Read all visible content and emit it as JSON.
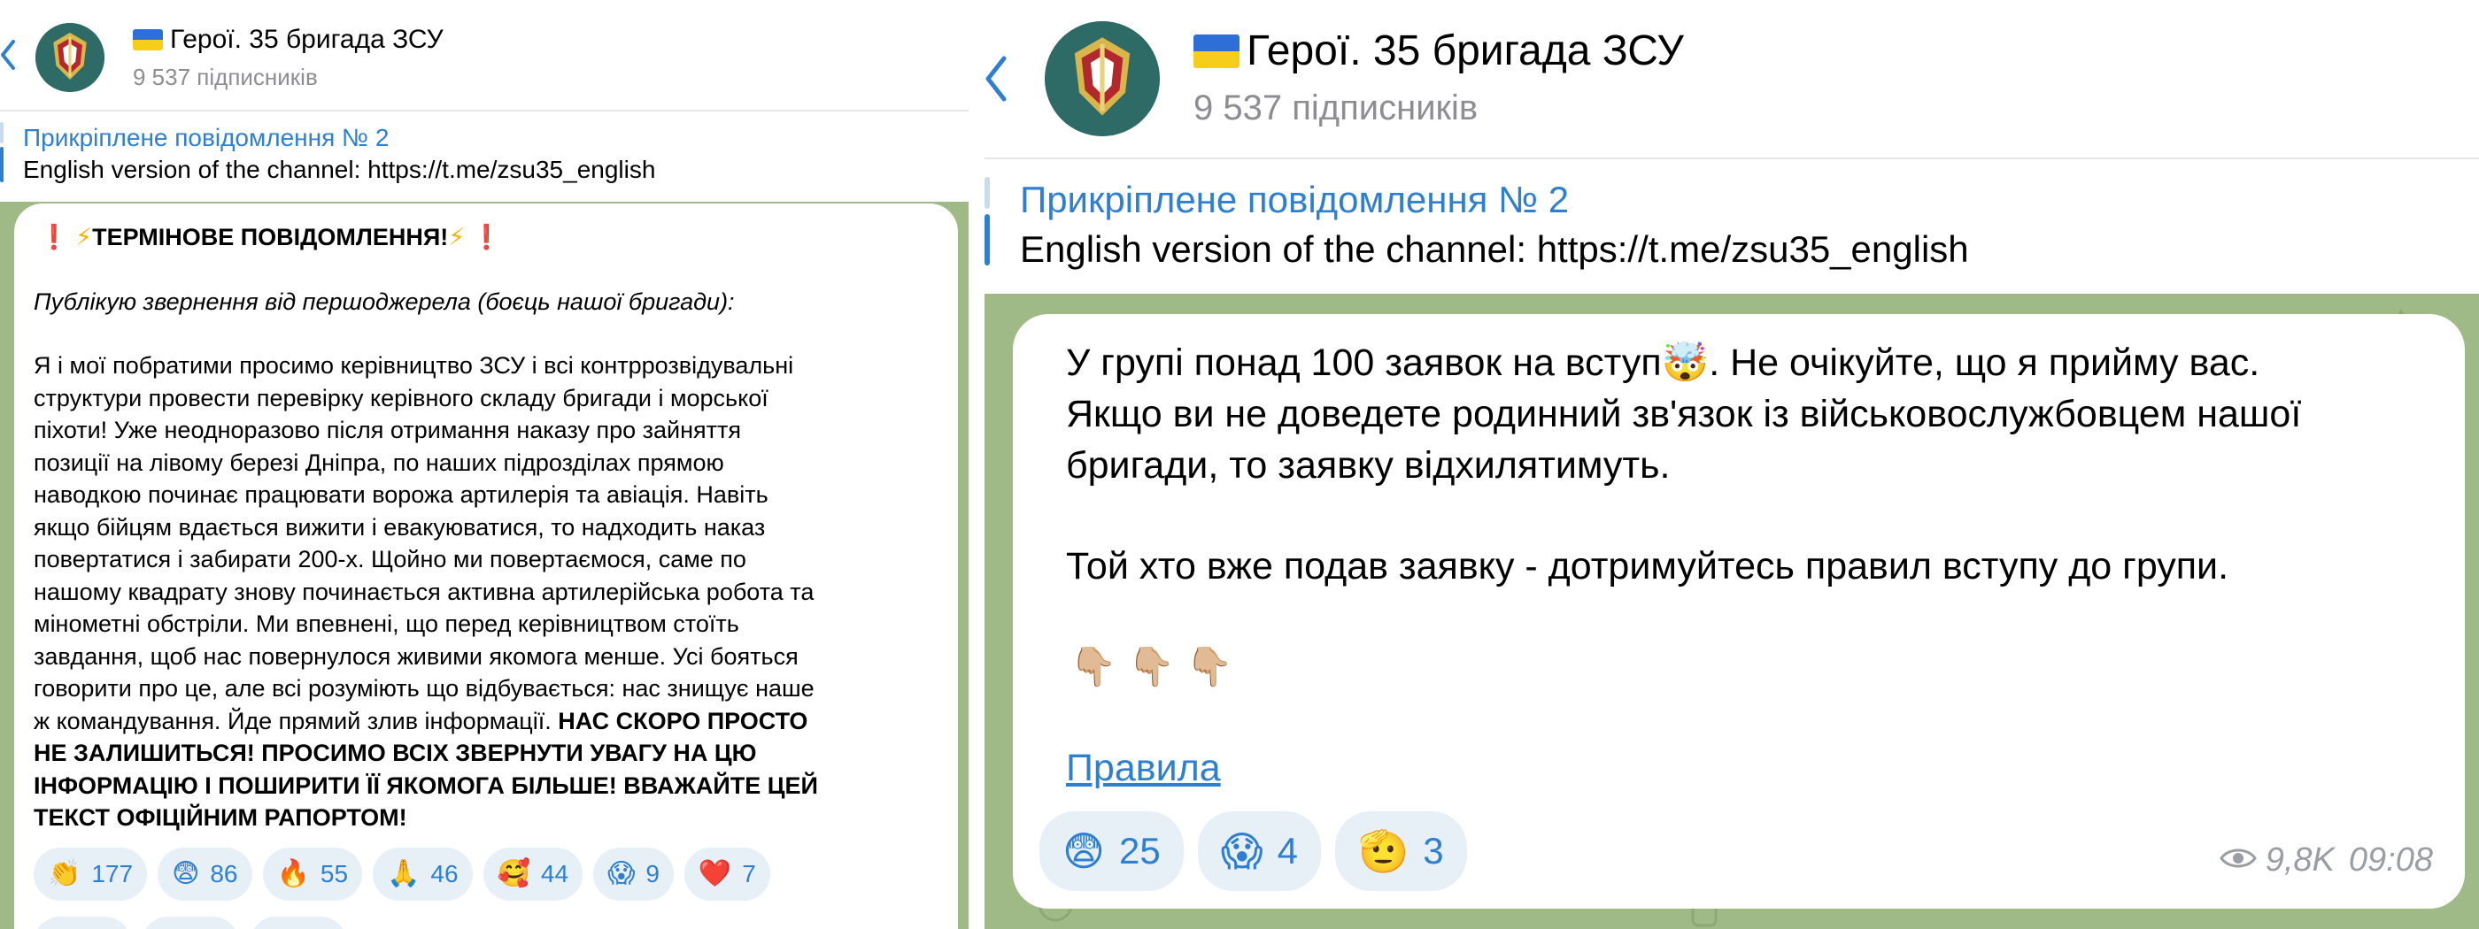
{
  "channel": {
    "name": "Герої. 35 бригада ЗСУ",
    "subscribers": "9 537 підписників",
    "colors": {
      "accent": "#2f7fd1",
      "chat_bg": "#9fba86",
      "reaction_bg": "#e8f0f7",
      "subtle": "#8d8d92"
    }
  },
  "pinned": {
    "title": "Прикріплене повідомлення № 2",
    "text": "English version of the channel: https://t.me/zsu35_english"
  },
  "left_message": {
    "headline": "ТЕРМІНОВЕ ПОВІДОМЛЕННЯ!",
    "headline_icons": [
      "red-exclamation-icon",
      "lightning-icon",
      "lightning-icon",
      "red-exclamation-icon"
    ],
    "intro": "Публікую звернення від першоджерела (боєць нашої бригади):",
    "lines": [
      "Я і мої побратими просимо керівництво ЗСУ і всі контррозвідувальні",
      "структури провести перевірку керівного складу бригади і морської",
      "піхоти! Уже неодноразово після отримання наказу про зайняття",
      "позиції на лівому березі Дніпра, по наших підрозділах прямою",
      "наводкою починає працювати ворожа артилерія та авіація. Навіть",
      "якщо бійцям вдається вижити і евакуюватися, то надходить наказ",
      "повертатися і забирати 200-х. Щойно ми повертаємося, саме по",
      "нашому квадрату знову починається активна артилерійська робота та",
      "мінометні обстріли. Ми впевнені, що перед керівництвом стоїть",
      "завдання, щоб нас повернулося живими якомога менше. Усі бояться",
      "говорити про це, але всі розуміють що відбувається: нас знищує наше"
    ],
    "last_line_plain": "ж командування. Йде прямий злив інформації. ",
    "last_line_bold": "НАС СКОРО ПРОСТО",
    "bold_lines": [
      "НЕ ЗАЛИШИТЬСЯ! ПРОСИМО ВСІХ ЗВЕРНУТИ УВАГУ НА ЦЮ",
      "ІНФОРМАЦІЮ І ПОШИРИТИ ЇЇ ЯКОМОГА БІЛЬШЕ! ВВАЖАЙТЕ ЦЕЙ",
      "ТЕКСТ ОФІЦІЙНИМ РАПОРТОМ!"
    ],
    "reactions": [
      {
        "emoji": "👏",
        "icon": "clapping-hands-icon",
        "count": "177"
      },
      {
        "emoji": "😨",
        "icon": "fearful-face-icon",
        "count": "86"
      },
      {
        "emoji": "🔥",
        "icon": "fire-icon",
        "count": "55"
      },
      {
        "emoji": "🙏",
        "icon": "folded-hands-icon",
        "count": "46"
      },
      {
        "emoji": "🥰",
        "icon": "smiling-hearts-face-icon",
        "count": "44"
      },
      {
        "emoji": "😱",
        "icon": "screaming-face-icon",
        "count": "9"
      },
      {
        "emoji": "❤️",
        "icon": "red-heart-icon",
        "count": "7"
      }
    ]
  },
  "right_message": {
    "line1": "У групі понад 100 заявок на вступ",
    "line1_icon": "exploding-head-icon",
    "line1_rest": ". Не очікуйте, що я прийму вас.",
    "line2": "Якщо ви не доведете родинний зв'язок із військовослужбовцем нашої",
    "line3": "бригади, то заявку відхилятимуть.",
    "line4": "Той хто вже подав заявку - дотримуйтесь правил вступу до групи.",
    "pointing_icons": [
      "pointing-down-icon",
      "pointing-down-icon",
      "pointing-down-icon"
    ],
    "link": "Правила",
    "reactions": [
      {
        "emoji": "😨",
        "icon": "fearful-face-icon",
        "count": "25"
      },
      {
        "emoji": "😱",
        "icon": "screaming-face-icon",
        "count": "4"
      },
      {
        "emoji": "🫡",
        "icon": "saluting-face-icon",
        "count": "3"
      }
    ],
    "views": "9,8K",
    "time": "09:08"
  }
}
